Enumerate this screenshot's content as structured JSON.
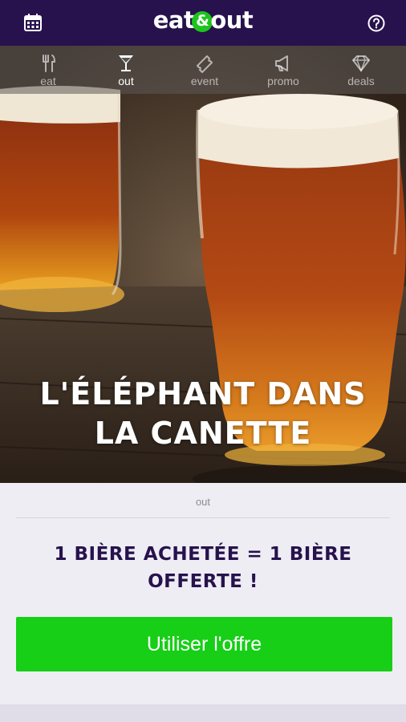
{
  "header": {
    "logo_left": "eat",
    "logo_amp": "&",
    "logo_right": "out",
    "calendar_icon": "calendar-icon",
    "help_icon": "help-circle-icon"
  },
  "categories": [
    {
      "label": "eat",
      "icon": "fork-knife-icon",
      "active": false
    },
    {
      "label": "out",
      "icon": "cocktail-glass-icon",
      "active": true
    },
    {
      "label": "event",
      "icon": "ticket-icon",
      "active": false
    },
    {
      "label": "promo",
      "icon": "megaphone-icon",
      "active": false
    },
    {
      "label": "deals",
      "icon": "diamond-icon",
      "active": false
    }
  ],
  "hero": {
    "title_line1": "L'ÉLÉPHANT DANS",
    "title_line2": "LA CANETTE"
  },
  "content": {
    "category": "out",
    "offer_line1": "1 BIÈRE ACHETÉE = 1 BIÈRE",
    "offer_line2": "OFFERTE !",
    "cta_label": "Utiliser l'offre"
  },
  "colors": {
    "header_bg": "#27124d",
    "accent_green": "#16cf16",
    "offer_text": "#27124d",
    "content_bg": "#eeedf4"
  }
}
